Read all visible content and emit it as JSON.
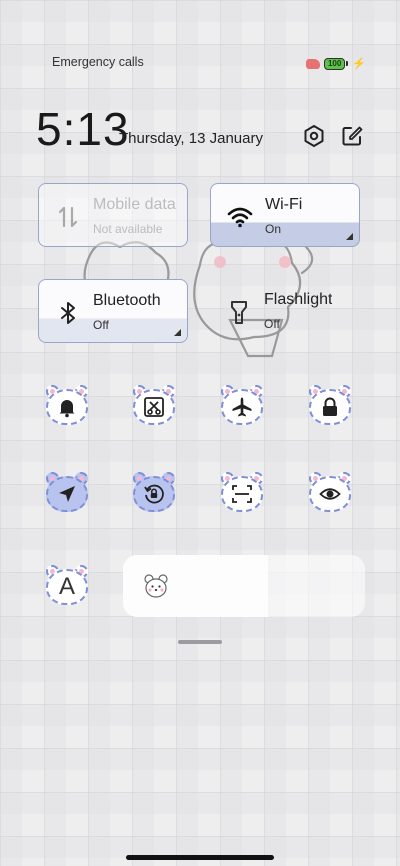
{
  "status": {
    "carrier": "Emergency calls",
    "battery": "100"
  },
  "header": {
    "time": "5:13",
    "date": "Thursday, 13 January"
  },
  "tiles": [
    {
      "id": "mobile-data",
      "title": "Mobile data",
      "sub": "Not available",
      "icon": "data-arrows-icon",
      "state": "disabled"
    },
    {
      "id": "wifi",
      "title": "Wi-Fi",
      "sub": "On",
      "icon": "wifi-icon",
      "state": "on"
    },
    {
      "id": "bluetooth",
      "title": "Bluetooth",
      "sub": "Off",
      "icon": "bluetooth-icon",
      "state": "off"
    },
    {
      "id": "flashlight",
      "title": "Flashlight",
      "sub": "Off",
      "icon": "flashlight-icon",
      "state": "off"
    }
  ],
  "toggles": [
    {
      "name": "ring-toggle",
      "icon": "bell-icon",
      "on": false
    },
    {
      "name": "screenshot-toggle",
      "icon": "scissors-icon",
      "on": false
    },
    {
      "name": "airplane-mode-toggle",
      "icon": "airplane-icon",
      "on": false
    },
    {
      "name": "lock-screen-toggle",
      "icon": "lock-icon",
      "on": false
    },
    {
      "name": "location-toggle",
      "icon": "location-arrow-icon",
      "on": true
    },
    {
      "name": "auto-rotate-toggle",
      "icon": "rotation-lock-icon",
      "on": true
    },
    {
      "name": "scanner-toggle",
      "icon": "scan-icon",
      "on": false
    },
    {
      "name": "reading-mode-toggle",
      "icon": "eye-icon",
      "on": false
    },
    {
      "name": "font-size-toggle",
      "icon": "letter-a-icon",
      "on": false,
      "glyph": "A"
    }
  ],
  "brightness": {
    "level": 0.6
  },
  "colors": {
    "accent": "#7f8fd6",
    "active_fill": "#b8c4ef",
    "battery": "#5cc24a"
  }
}
